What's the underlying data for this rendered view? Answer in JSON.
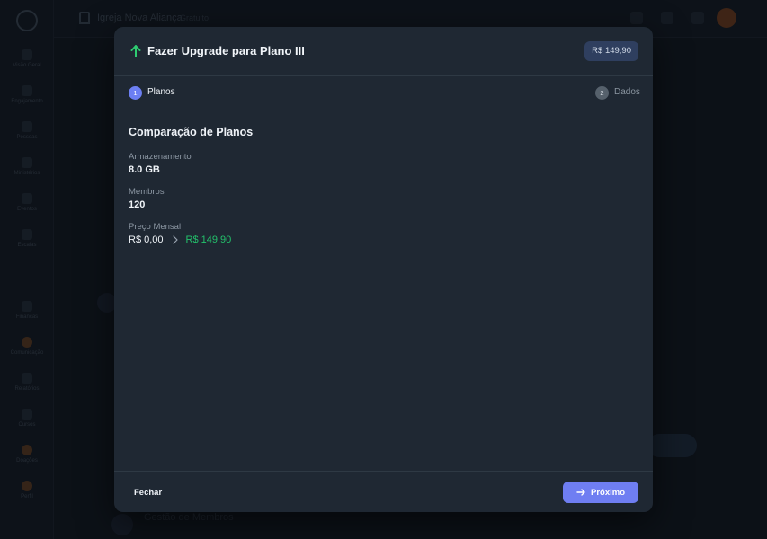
{
  "background": {
    "church_name": "Igreja Nova Aliança",
    "church_role": "Gratuito",
    "sidebar_items": [
      {
        "label": "Visão Geral"
      },
      {
        "label": "Engajamento"
      },
      {
        "label": "Pessoas"
      },
      {
        "label": "Ministérios"
      },
      {
        "label": "Eventos"
      },
      {
        "label": "Escalas"
      },
      {
        "label": "Finanças"
      },
      {
        "label": "Comunicação"
      },
      {
        "label": "Relatórios"
      },
      {
        "label": "Cursos"
      },
      {
        "label": "Doações"
      },
      {
        "label": "Perfil"
      }
    ],
    "footer_text": "Gestão de Membros"
  },
  "modal": {
    "title": "Fazer Upgrade para Plano III",
    "price_badge": "R$ 149,90",
    "icon": "arrow-up-icon",
    "steps": [
      {
        "number": "1",
        "label": "Planos",
        "active": true
      },
      {
        "number": "2",
        "label": "Dados",
        "active": false
      }
    ],
    "section_title": "Comparação de Planos",
    "fields": [
      {
        "label": "Armazenamento",
        "value": "8.0 GB"
      },
      {
        "label": "Membros",
        "value": "120"
      }
    ],
    "price": {
      "label": "Preço Mensal",
      "old": "R$ 0,00",
      "new": "R$ 149,90"
    },
    "close_label": "Fechar",
    "next_label": "Próximo"
  },
  "colors": {
    "accent": "#6f7ef2",
    "success": "#23c16b",
    "modal_bg": "#1f2833"
  }
}
